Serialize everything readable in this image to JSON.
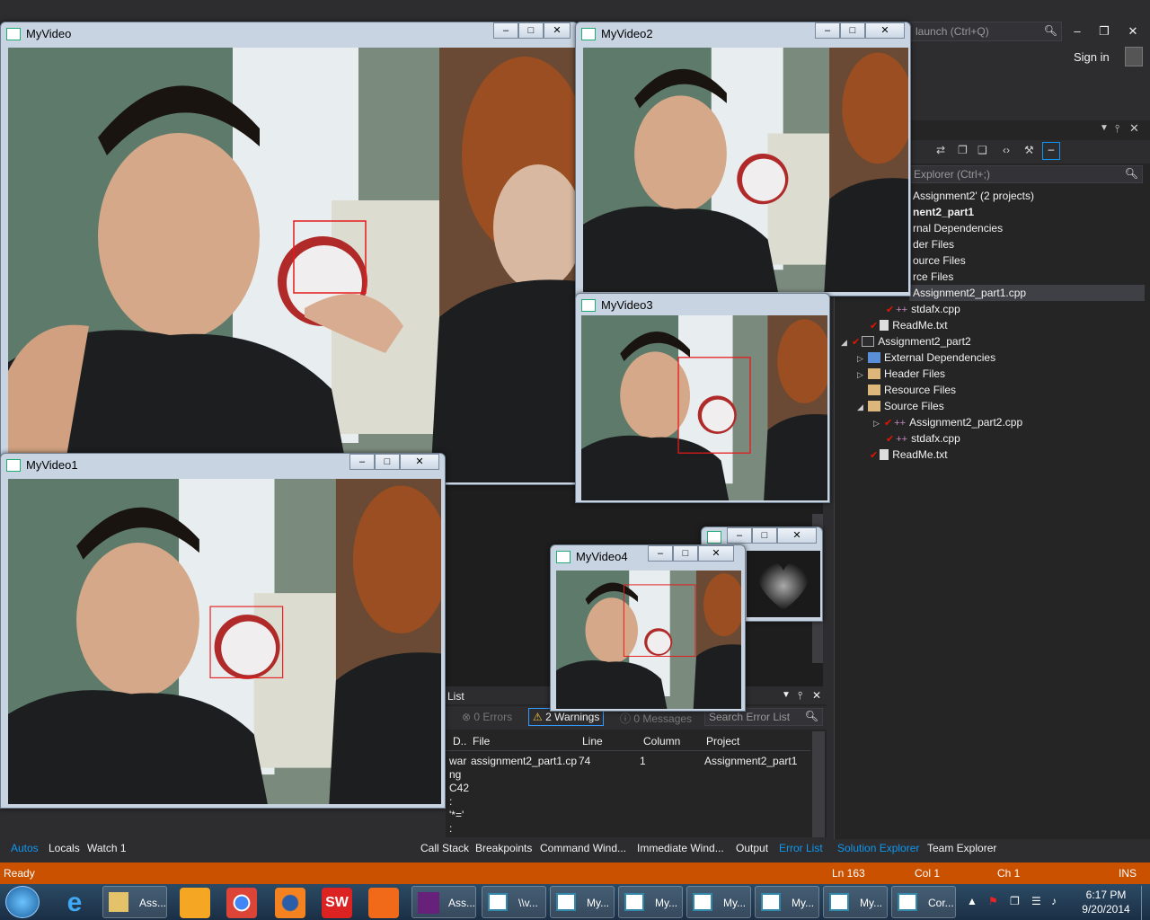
{
  "vs": {
    "quick_launch_placeholder": "launch (Ctrl+Q)",
    "sign_in": "Sign in",
    "se_search_placeholder": "Explorer (Ctrl+;)",
    "tree": [
      {
        "label": "Assignment2' (2 projects)"
      },
      {
        "label": "nent2_part1"
      },
      {
        "label": "rnal Dependencies"
      },
      {
        "label": "der Files"
      },
      {
        "label": "ource Files"
      },
      {
        "label": "rce Files"
      },
      {
        "label": "Assignment2_part1.cpp"
      },
      {
        "label": "stdafx.cpp"
      },
      {
        "label": "ReadMe.txt"
      },
      {
        "label": "Assignment2_part2"
      },
      {
        "label": "External Dependencies"
      },
      {
        "label": "Header Files"
      },
      {
        "label": "Resource Files"
      },
      {
        "label": "Source Files"
      },
      {
        "label": "Assignment2_part2.cpp"
      },
      {
        "label": "stdafx.cpp"
      },
      {
        "label": "ReadMe.txt"
      }
    ],
    "error_list": {
      "title": "List",
      "errors": "0 Errors",
      "warnings": "2 Warnings",
      "messages": "0 Messages",
      "search_placeholder": "Search Error List",
      "columns": [
        "D..",
        "File",
        "Line",
        "Column",
        "Project"
      ],
      "row": {
        "desc_lines": [
          "war",
          "ng",
          "C42",
          ":",
          "'*='",
          ":"
        ],
        "file": "assignment2_part1.cp",
        "line": "74",
        "column": "1",
        "project": "Assignment2_part1"
      }
    },
    "bottom_left_tabs": [
      "Autos",
      "Locals",
      "Watch 1"
    ],
    "bottom_mid_tabs": [
      "Call Stack",
      "Breakpoints",
      "Command Wind...",
      "Immediate Wind...",
      "Output",
      "Error List"
    ],
    "bottom_right_tabs": [
      "Solution Explorer",
      "Team Explorer"
    ],
    "status": {
      "ready": "Ready",
      "ln": "Ln 163",
      "col": "Col 1",
      "ch": "Ch 1",
      "ins": "INS"
    }
  },
  "windows": {
    "myvideo": "MyVideo",
    "myvideo1": "MyVideo1",
    "myvideo2": "MyVideo2",
    "myvideo3": "MyVideo3",
    "myvideo4": "MyVideo4"
  },
  "taskbar": {
    "items": [
      "Ass...",
      "\\\\v...",
      "My...",
      "My...",
      "My...",
      "My...",
      "My...",
      "Cor...",
      "Ass..."
    ],
    "time": "6:17 PM",
    "date": "9/20/2014"
  },
  "colors": {
    "status_bar": "#ca5100",
    "accent": "#0e97f0",
    "detection_box": "#e51a1a"
  }
}
